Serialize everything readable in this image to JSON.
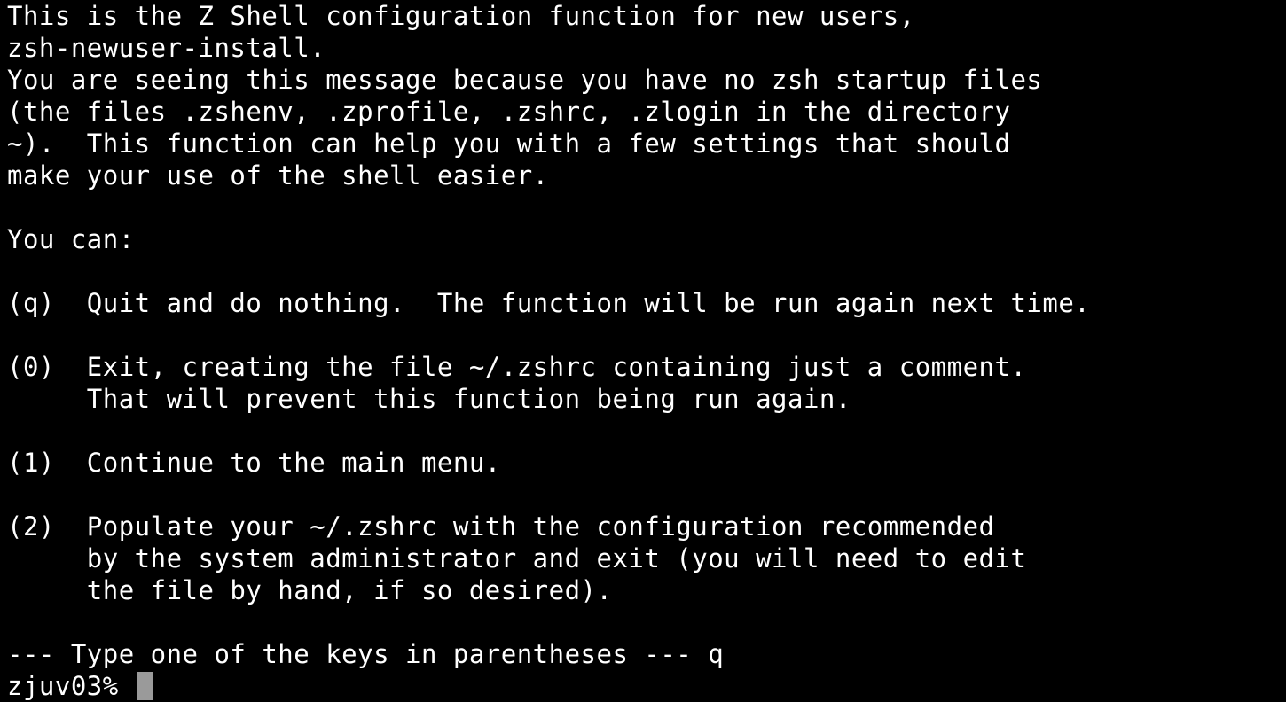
{
  "terminal": {
    "lines": [
      "This is the Z Shell configuration function for new users,",
      "zsh-newuser-install.",
      "You are seeing this message because you have no zsh startup files",
      "(the files .zshenv, .zprofile, .zshrc, .zlogin in the directory",
      "~).  This function can help you with a few settings that should",
      "make your use of the shell easier.",
      "",
      "You can:",
      "",
      "(q)  Quit and do nothing.  The function will be run again next time.",
      "",
      "(0)  Exit, creating the file ~/.zshrc containing just a comment.",
      "     That will prevent this function being run again.",
      "",
      "(1)  Continue to the main menu.",
      "",
      "(2)  Populate your ~/.zshrc with the configuration recommended",
      "     by the system administrator and exit (you will need to edit",
      "     the file by hand, if so desired).",
      "",
      "--- Type one of the keys in parentheses --- q"
    ],
    "prompt": "zjuv03% ",
    "colors": {
      "background": "#000000",
      "foreground": "#ffffff",
      "cursor": "#9a9a9a"
    }
  }
}
